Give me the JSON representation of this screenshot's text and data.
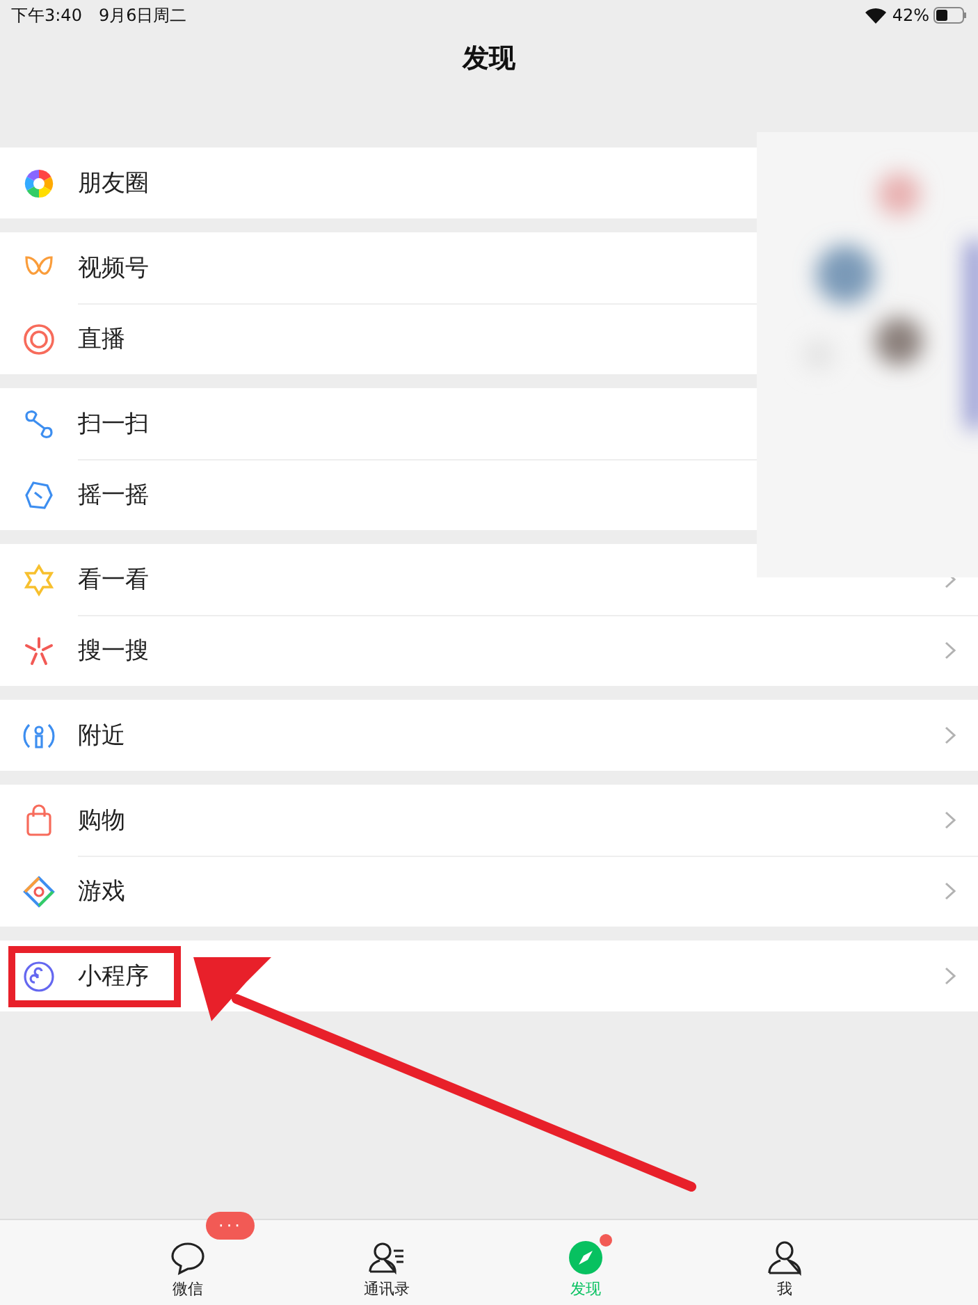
{
  "status_bar": {
    "time": "下午3:40",
    "date": "9月6日周二",
    "battery": "42%"
  },
  "title": "发现",
  "groups": [
    {
      "items": [
        {
          "kind": "moments",
          "label": "朋友圈"
        }
      ]
    },
    {
      "items": [
        {
          "kind": "channels",
          "label": "视频号"
        },
        {
          "kind": "live",
          "label": "直播"
        }
      ]
    },
    {
      "items": [
        {
          "kind": "scan",
          "label": "扫一扫"
        },
        {
          "kind": "shake",
          "label": "摇一摇"
        }
      ]
    },
    {
      "items": [
        {
          "kind": "top",
          "label": "看一看"
        },
        {
          "kind": "search",
          "label": "搜一搜"
        }
      ]
    },
    {
      "items": [
        {
          "kind": "nearby",
          "label": "附近"
        }
      ]
    },
    {
      "items": [
        {
          "kind": "shop",
          "label": "购物"
        },
        {
          "kind": "games",
          "label": "游戏"
        }
      ]
    },
    {
      "items": [
        {
          "kind": "mini",
          "label": "小程序",
          "highlighted": true
        }
      ]
    }
  ],
  "tabs": [
    {
      "kind": "chats",
      "label": "微信",
      "selected": false,
      "badge": "···"
    },
    {
      "kind": "contacts",
      "label": "通讯录",
      "selected": false
    },
    {
      "kind": "discover",
      "label": "发现",
      "selected": true,
      "dot": true
    },
    {
      "kind": "me",
      "label": "我",
      "selected": false
    }
  ]
}
